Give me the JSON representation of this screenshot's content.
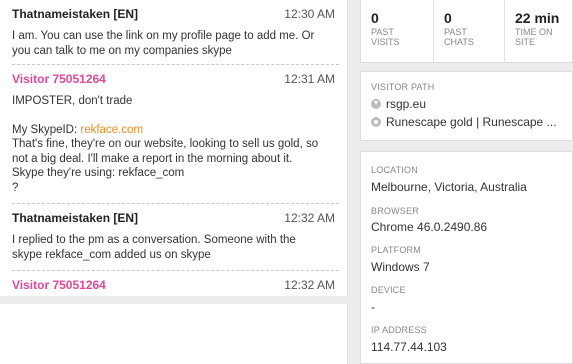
{
  "chat": {
    "messages": [
      {
        "author": "Thatnameistaken [EN]",
        "time": "12:30 AM",
        "lines": [
          "I am. You can use the link on my profile page to add me. Or",
          "you can talk to me on my companies skype"
        ]
      },
      {
        "author": "Visitor 75051264",
        "time": "12:31 AM",
        "line1": "IMPOSTER, don't trade",
        "skype_label": "My SkypeID: ",
        "skype_link": "rekface.com",
        "rest": [
          "That's fine, they're on our website, looking to sell us gold, so",
          "not a big deal. I'll make a report in the morning about it.",
          "Skype they're using: rekface_com",
          "?"
        ]
      },
      {
        "author": "Thatnameistaken [EN]",
        "time": "12:32 AM",
        "lines": [
          "I replied to the pm as a conversation. Someone with the",
          "skype rekface_com added us on skype"
        ]
      },
      {
        "author": "Visitor 75051264",
        "time": "12:32 AM"
      }
    ]
  },
  "stats": [
    {
      "value": "0",
      "label_lines": [
        "PAST",
        "VISITS"
      ]
    },
    {
      "value": "0",
      "label_lines": [
        "PAST",
        "CHATS"
      ]
    },
    {
      "value": "22 min",
      "label_lines": [
        "TIME ON",
        "SITE"
      ]
    }
  ],
  "visitor_path": {
    "title": "VISITOR PATH",
    "items": [
      {
        "icon": "download-arrow-icon",
        "text": "rsgp.eu"
      },
      {
        "icon": "page-dot-icon",
        "text": "Runescape gold | Runescape ..."
      }
    ]
  },
  "details": {
    "location_label": "LOCATION",
    "location": "Melbourne, Victoria, Australia",
    "browser_label": "BROWSER",
    "browser": "Chrome 46.0.2490.86",
    "platform_label": "PLATFORM",
    "platform": "Windows 7",
    "device_label": "DEVICE",
    "device": "-",
    "ip_label": "IP ADDRESS",
    "ip": "114.77.44.103"
  },
  "colors": {
    "visitor_name": "#e0489a",
    "link": "#f28b1a"
  }
}
